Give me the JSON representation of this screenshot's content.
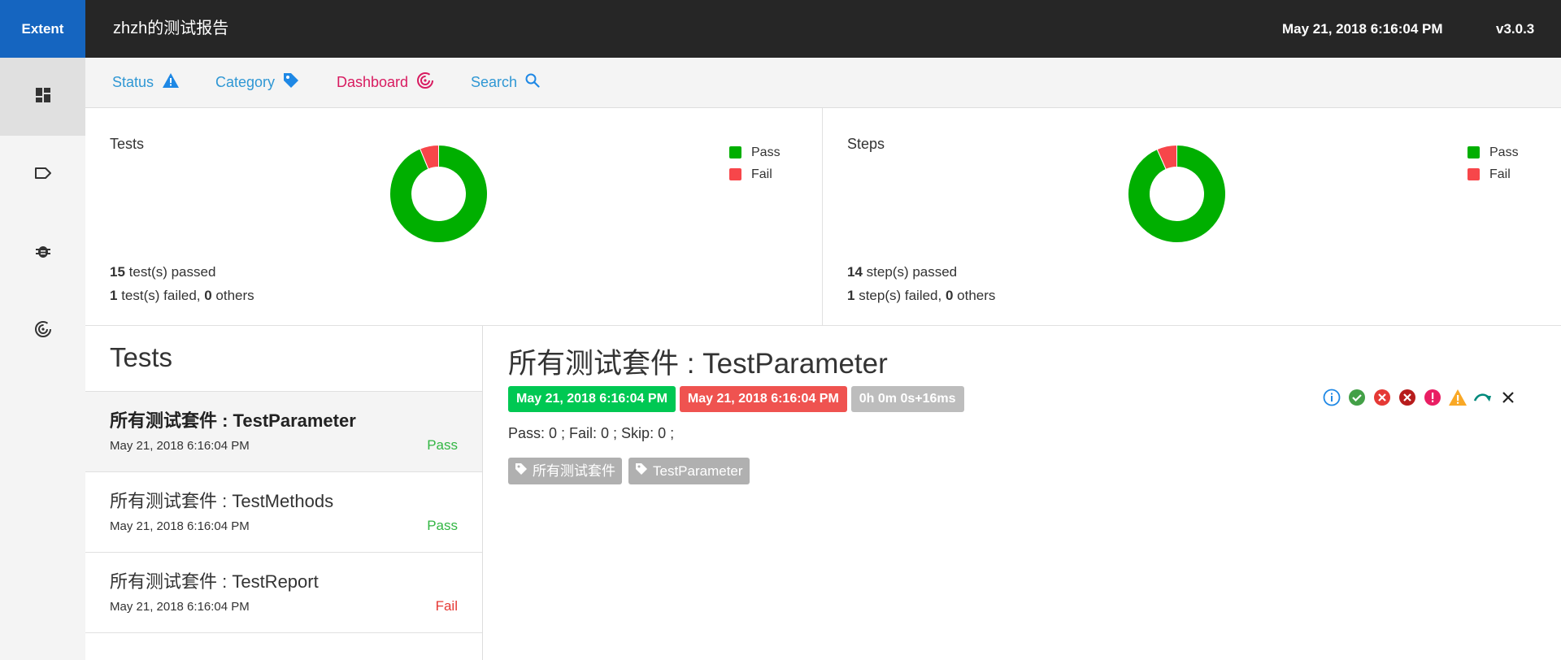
{
  "brand": "Extent",
  "report_name": "zhzh的测试报告",
  "top_date": "May 21, 2018 6:16:04 PM",
  "version": "v3.0.3",
  "sidenav": {
    "icons": [
      "dashboard-grid-icon",
      "tag-icon",
      "bug-icon",
      "chart-target-icon"
    ]
  },
  "subnav": {
    "status": "Status",
    "category": "Category",
    "dashboard": "Dashboard",
    "search": "Search"
  },
  "charts": {
    "tests": {
      "title": "Tests",
      "pass_count": "15",
      "pass_text": " test(s) passed",
      "fail_count": "1",
      "fail_text": " test(s) failed, ",
      "other_count": "0",
      "other_text": " others",
      "legend": [
        "Pass",
        "Fail"
      ]
    },
    "steps": {
      "title": "Steps",
      "pass_count": "14",
      "pass_text": " step(s) passed",
      "fail_count": "1",
      "fail_text": " step(s) failed, ",
      "other_count": "0",
      "other_text": " others",
      "legend": [
        "Pass",
        "Fail"
      ]
    }
  },
  "chart_data": [
    {
      "type": "pie",
      "categories": [
        "Pass",
        "Fail"
      ],
      "values": [
        15,
        1
      ],
      "colors": [
        "#00af00",
        "#f7464a"
      ]
    },
    {
      "type": "pie",
      "categories": [
        "Pass",
        "Fail"
      ],
      "values": [
        14,
        1
      ],
      "colors": [
        "#00af00",
        "#f7464a"
      ]
    }
  ],
  "colors": {
    "pass": "#00af00",
    "fail": "#f7464a",
    "brand": "#1565c0"
  },
  "list": {
    "title": "Tests",
    "items": [
      {
        "name": "所有测试套件 : TestParameter",
        "time": "May 21, 2018 6:16:04 PM",
        "status": "Pass"
      },
      {
        "name": "所有测试套件 : TestMethods",
        "time": "May 21, 2018 6:16:04 PM",
        "status": "Pass"
      },
      {
        "name": "所有测试套件 : TestReport",
        "time": "May 21, 2018 6:16:04 PM",
        "status": "Fail"
      }
    ]
  },
  "detail": {
    "title": "所有测试套件 : TestParameter",
    "start": "May 21, 2018 6:16:04 PM",
    "end": "May 21, 2018 6:16:04 PM",
    "duration": "0h 0m 0s+16ms",
    "counts": "Pass: 0 ; Fail: 0 ; Skip: 0 ;",
    "tags": [
      "所有测试套件",
      "TestParameter"
    ],
    "filters": [
      "info-icon",
      "pass-check-icon",
      "fail-x-icon",
      "fatal-x-icon",
      "error-icon",
      "warning-icon",
      "skip-arrow-icon",
      "clear-x-icon"
    ]
  }
}
